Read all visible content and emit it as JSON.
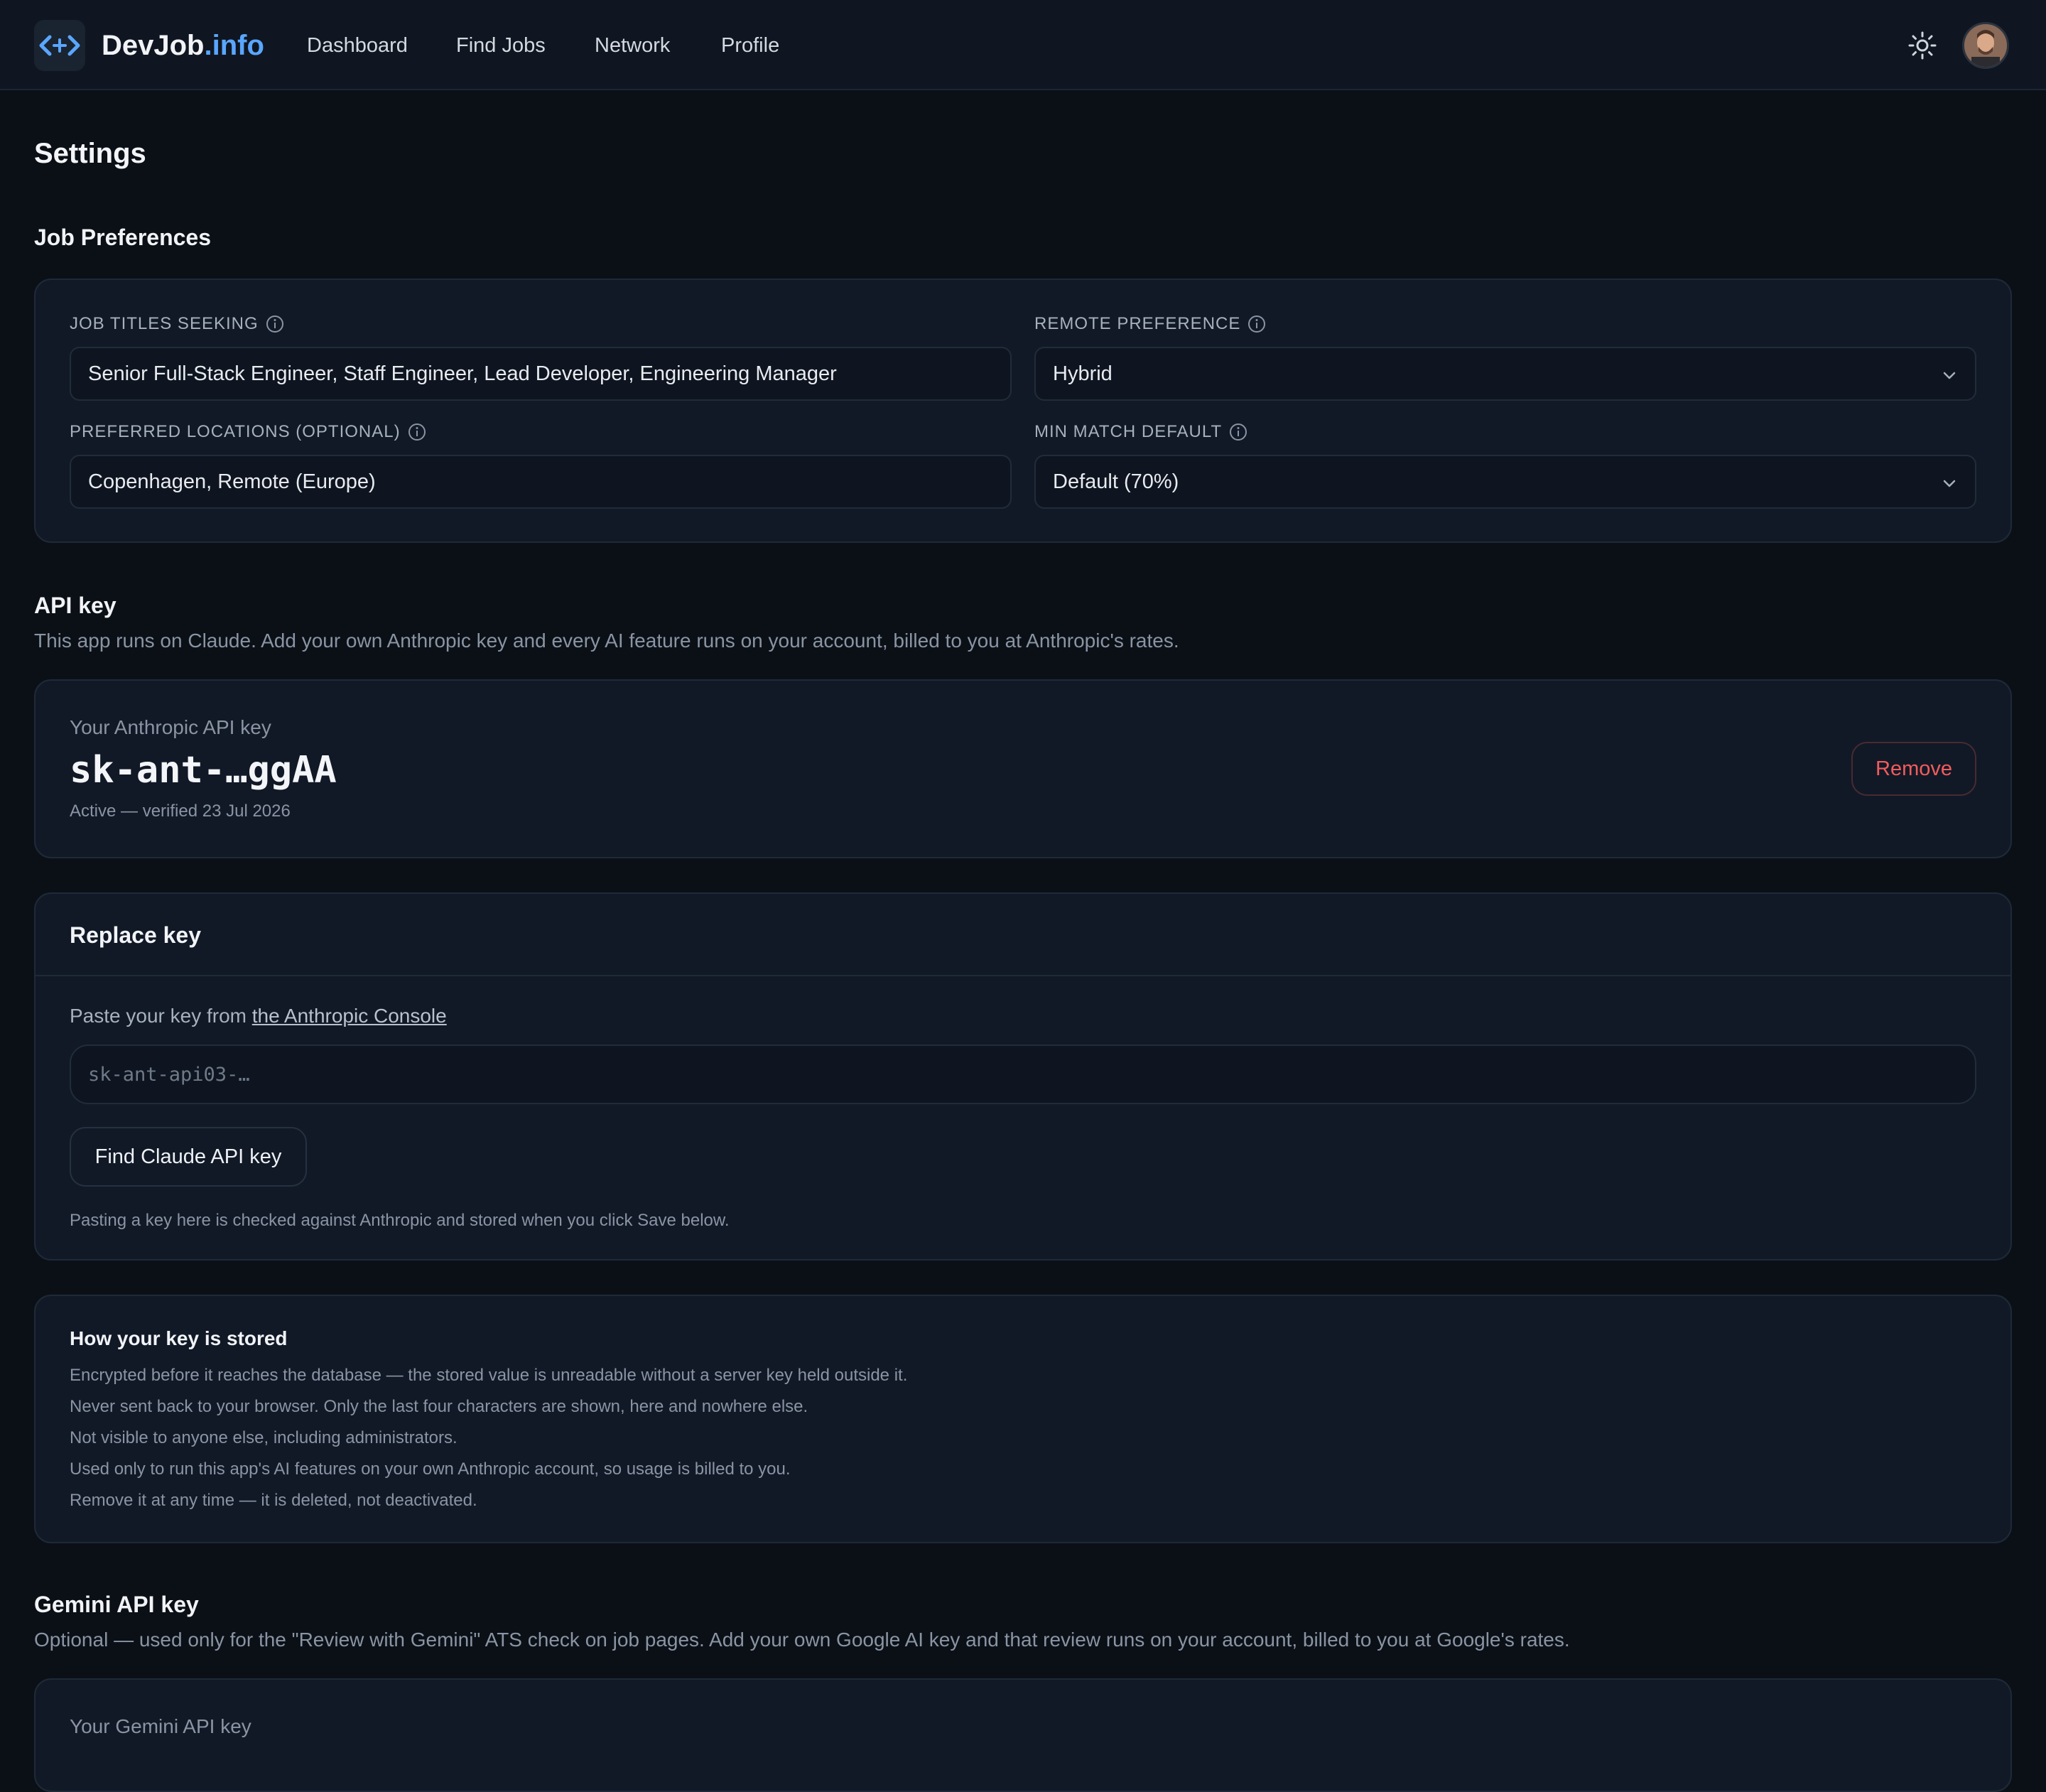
{
  "nav": {
    "brand_main": "DevJob",
    "brand_accent": ".info",
    "links": [
      "Dashboard",
      "Find Jobs",
      "Network",
      "Profile"
    ]
  },
  "page_title": "Settings",
  "job_preferences": {
    "title": "Job Preferences",
    "job_titles_label": "JOB TITLES SEEKING",
    "job_titles_value": "Senior Full-Stack Engineer, Staff Engineer, Lead Developer, Engineering Manager",
    "remote_label": "REMOTE PREFERENCE",
    "remote_value": "Hybrid",
    "locations_label": "PREFERRED LOCATIONS (OPTIONAL)",
    "locations_value": "Copenhagen, Remote (Europe)",
    "min_match_label": "MIN MATCH DEFAULT",
    "min_match_value": "Default (70%)"
  },
  "api_key": {
    "title": "API key",
    "description": "This app runs on Claude. Add your own Anthropic key and every AI feature runs on your account, billed to you at Anthropic's rates.",
    "current_label": "Your Anthropic API key",
    "current_value": "sk-ant-…ggAA",
    "status": "Active — verified 23 Jul 2026",
    "remove_label": "Remove"
  },
  "replace_key": {
    "title": "Replace key",
    "paste_prefix": "Paste your key from ",
    "paste_link": "the Anthropic Console",
    "input_placeholder": "sk-ant-api03-…",
    "find_button": "Find Claude API key",
    "note": "Pasting a key here is checked against Anthropic and stored when you click Save below."
  },
  "storage": {
    "title": "How your key is stored",
    "lines": [
      "Encrypted before it reaches the database — the stored value is unreadable without a server key held outside it.",
      "Never sent back to your browser. Only the last four characters are shown, here and nowhere else.",
      "Not visible to anyone else, including administrators.",
      "Used only to run this app's AI features on your own Anthropic account, so usage is billed to you.",
      "Remove it at any time — it is deleted, not deactivated."
    ]
  },
  "gemini": {
    "title": "Gemini API key",
    "description": "Optional — used only for the \"Review with Gemini\" ATS check on job pages. Add your own Google AI key and that review runs on your account, billed to you at Google's rates.",
    "current_label": "Your Gemini API key"
  },
  "colors": {
    "accent": "#5aa6ff",
    "danger": "#f25c5c",
    "background": "#0b1017",
    "card": "#111927"
  },
  "icons": [
    "code-brackets-icon",
    "sun-icon",
    "info-icon",
    "chevron-down-icon"
  ]
}
